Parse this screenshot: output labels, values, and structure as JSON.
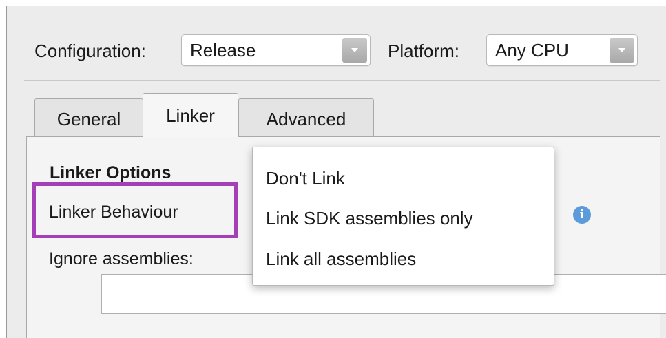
{
  "toolbar": {
    "configuration_label": "Configuration:",
    "configuration_value": "Release",
    "platform_label": "Platform:",
    "platform_value": "Any CPU"
  },
  "tabs": [
    {
      "label": "General",
      "active": false
    },
    {
      "label": "Linker",
      "active": true
    },
    {
      "label": "Advanced",
      "active": false
    }
  ],
  "panel": {
    "section_title": "Linker Options",
    "linker_behaviour_label": "Linker Behaviour",
    "ignore_assemblies_label": "Ignore assemblies:",
    "ignore_assemblies_value": ""
  },
  "menu": {
    "items": [
      {
        "label": "Don't Link"
      },
      {
        "label": "Link SDK assemblies only"
      },
      {
        "label": "Link all assemblies"
      }
    ]
  },
  "icons": {
    "info": "info-icon",
    "dropdown_arrow": "chevron-down-icon"
  },
  "colors": {
    "highlight": "#a53fb8",
    "info_icon": "#5b9bd9",
    "window_background": "#ececec"
  }
}
